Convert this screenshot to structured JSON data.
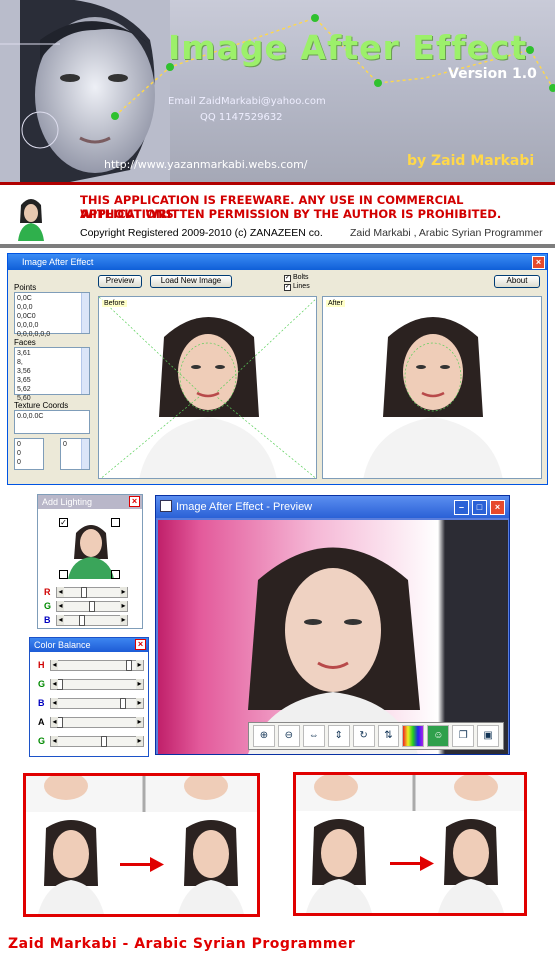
{
  "banner": {
    "title": "Image After Effect",
    "version": "Version 1.0",
    "email": "Email  ZaidMarkabi@yahoo.com",
    "qq": "QQ   1147529632",
    "url": "http://www.yazanmarkabi.webs.com/",
    "byline": "by  Zaid Markabi"
  },
  "notice": {
    "line1": "THIS APPLICATION IS FREEWARE. ANY USE IN COMMERCIAL APPLICATIONS",
    "line2": "WITHOUT WRITTEN PERMISSION BY THE AUTHOR IS PROHIBITED.",
    "copyright": "Copyright Registered 2009-2010 (c) ZANAZEEN co.",
    "credit": "Zaid Markabi ,  Arabic Syrian Programmer"
  },
  "main_window": {
    "title": "Image After Effect",
    "points_label": "Points",
    "points_items": [
      "0,0C",
      "0,0,0",
      "0,0C0",
      "0,0,0,0",
      "0,0,0,0,0,0"
    ],
    "faces_label": "Faces",
    "faces_items": [
      "3,61",
      "8,",
      "3,56",
      "3,65",
      "5,62",
      "5,60"
    ],
    "texture_label": "Texture Coords",
    "texture_value": "0.0,0.0C",
    "small_values": [
      "0",
      "0",
      "0",
      "0"
    ],
    "preview_button": "Preview",
    "load_button": "Load New Image",
    "about_button": "About",
    "check_bolts": "Bolts",
    "check_lines": "Lines",
    "before_label": "Before",
    "after_label": "After"
  },
  "lighting": {
    "title": "Add Lighting",
    "channels": [
      "R",
      "G",
      "B"
    ],
    "levels": [
      0.35,
      0.5,
      0.3
    ]
  },
  "color_balance": {
    "title": "Color Balance",
    "channels": [
      "H",
      "G",
      "B",
      "A",
      "G"
    ],
    "levels": [
      0.93,
      0.0,
      0.85,
      0.0,
      0.6
    ]
  },
  "preview_window": {
    "title": "Image After Effect - Preview",
    "tools": [
      "zoom-in-icon",
      "zoom-out-icon",
      "fit-width-icon",
      "fit-height-icon",
      "rotate-icon",
      "flip-icon",
      "palette-icon",
      "face-icon",
      "copy-icon",
      "save-icon"
    ]
  },
  "footer": "Zaid Markabi - Arabic Syrian Programmer",
  "colors": {
    "accent_red": "#e00000",
    "title_green": "#9cf06a",
    "byline_gold": "#ffd84a",
    "xp_blue": "#0054e3"
  }
}
